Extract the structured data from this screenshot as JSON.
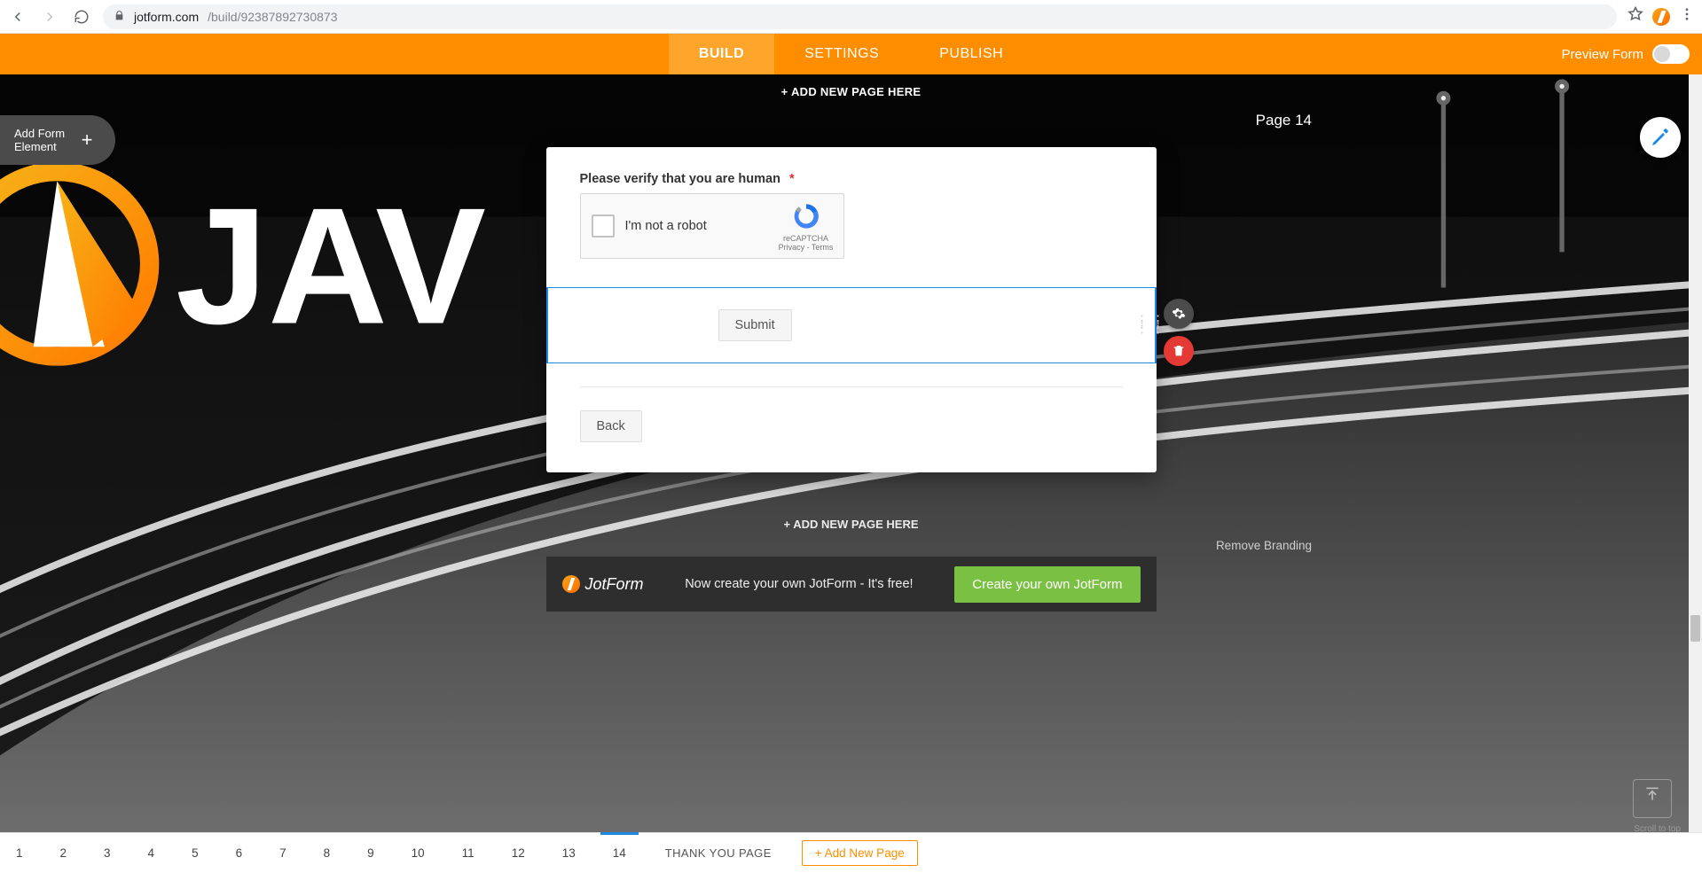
{
  "browser": {
    "domain": "jotform.com",
    "path": "/build/92387892730873"
  },
  "top_nav": {
    "tabs": [
      "BUILD",
      "SETTINGS",
      "PUBLISH"
    ],
    "active_index": 0,
    "preview_label": "Preview Form"
  },
  "add_element": {
    "line1": "Add Form",
    "line2": "Element"
  },
  "workspace": {
    "add_page_top": "+ ADD NEW PAGE HERE",
    "add_page_bottom": "+ ADD NEW PAGE HERE",
    "page_label": "Page 14",
    "remove_branding": "Remove Branding",
    "scroll_to_top": "Scroll to top"
  },
  "form": {
    "captcha_label": "Please verify that you are human",
    "required_mark": "*",
    "captcha_text": "I'm not a robot",
    "captcha_brand": "reCAPTCHA",
    "captcha_links": "Privacy - Terms",
    "submit_label": "Submit",
    "back_label": "Back"
  },
  "promo": {
    "brand": "JotForm",
    "message": "Now create your own JotForm - It's free!",
    "cta": "Create your own JotForm"
  },
  "pager": {
    "pages": [
      "1",
      "2",
      "3",
      "4",
      "5",
      "6",
      "7",
      "8",
      "9",
      "10",
      "11",
      "12",
      "13",
      "14"
    ],
    "active_index": 13,
    "thank_you": "THANK YOU PAGE",
    "add_new": "+ Add New Page"
  },
  "bg_text": "JAV"
}
